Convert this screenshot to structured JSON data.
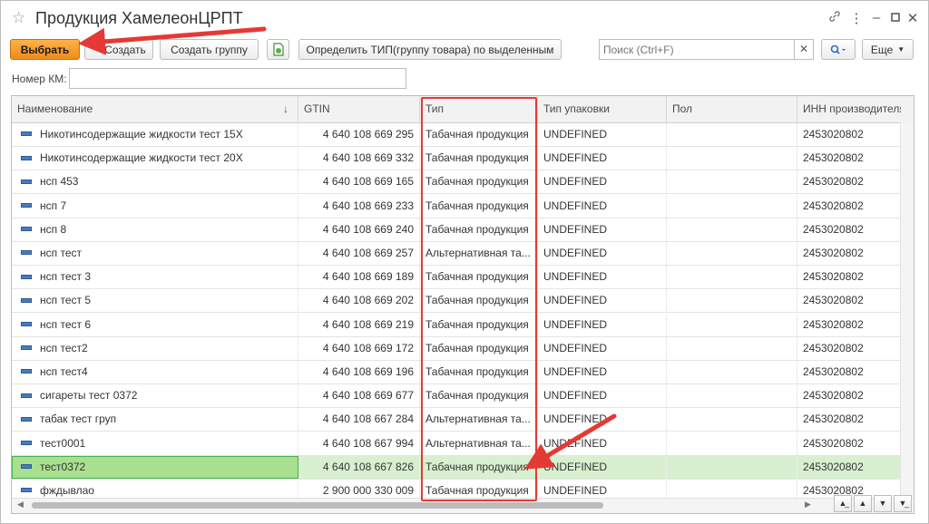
{
  "window": {
    "title": "Продукция ХамелеонЦРПТ",
    "favorite_icon": "star-icon",
    "controls": [
      "link-icon",
      "more-icon",
      "minimize-icon",
      "maximize-icon",
      "close-icon"
    ]
  },
  "toolbar": {
    "select_label": "Выбрать",
    "create_label": "Создать",
    "create_group_label": "Создать группу",
    "determine_type_label": "Определить ТИП(группу товара) по выделенным",
    "search_placeholder": "Поиск (Ctrl+F)",
    "more_label": "Еще",
    "accent_color": "#f08a1c"
  },
  "filter": {
    "km_label": "Номер КМ:",
    "km_value": ""
  },
  "table": {
    "columns": [
      "Наименование",
      "GTIN",
      "Тип",
      "Тип упаковки",
      "Пол",
      "ИНН производителя/..."
    ],
    "sort_indicator": "↓",
    "rows": [
      [
        "Никотинсодержащие жидкости тест 15X",
        "4 640 108 669 295",
        "Табачная продукция",
        "UNDEFINED",
        "",
        "2453020802"
      ],
      [
        "Никотинсодержащие жидкости тест 20X",
        "4 640 108 669 332",
        "Табачная продукция",
        "UNDEFINED",
        "",
        "2453020802"
      ],
      [
        "нсп 453",
        "4 640 108 669 165",
        "Табачная продукция",
        "UNDEFINED",
        "",
        "2453020802"
      ],
      [
        "нсп 7",
        "4 640 108 669 233",
        "Табачная продукция",
        "UNDEFINED",
        "",
        "2453020802"
      ],
      [
        "нсп 8",
        "4 640 108 669 240",
        "Табачная продукция",
        "UNDEFINED",
        "",
        "2453020802"
      ],
      [
        "нсп тест",
        "4 640 108 669 257",
        "Альтернативная та...",
        "UNDEFINED",
        "",
        "2453020802"
      ],
      [
        "нсп тест 3",
        "4 640 108 669 189",
        "Табачная продукция",
        "UNDEFINED",
        "",
        "2453020802"
      ],
      [
        "нсп тест 5",
        "4 640 108 669 202",
        "Табачная продукция",
        "UNDEFINED",
        "",
        "2453020802"
      ],
      [
        "нсп тест 6",
        "4 640 108 669 219",
        "Табачная продукция",
        "UNDEFINED",
        "",
        "2453020802"
      ],
      [
        "нсп тест2",
        "4 640 108 669 172",
        "Табачная продукция",
        "UNDEFINED",
        "",
        "2453020802"
      ],
      [
        "нсп тест4",
        "4 640 108 669 196",
        "Табачная продукция",
        "UNDEFINED",
        "",
        "2453020802"
      ],
      [
        "сигареты тест 0372",
        "4 640 108 669 677",
        "Табачная продукция",
        "UNDEFINED",
        "",
        "2453020802"
      ],
      [
        "табак тест груп",
        "4 640 108 667 284",
        "Альтернативная та...",
        "UNDEFINED",
        "",
        "2453020802"
      ],
      [
        "тест0001",
        "4 640 108 667 994",
        "Альтернативная та...",
        "UNDEFINED",
        "",
        "2453020802"
      ],
      [
        "тест0372",
        "4 640 108 667 826",
        "Табачная продукция",
        "UNDEFINED",
        "",
        "2453020802"
      ],
      [
        "фждывлао",
        "2 900 000 330 009",
        "Табачная продукция",
        "UNDEFINED",
        "",
        "2453020802"
      ]
    ],
    "selected_row": 14,
    "selected_color": "#d8f0d0"
  },
  "annotations": {
    "highlight_color": "#e53935"
  }
}
